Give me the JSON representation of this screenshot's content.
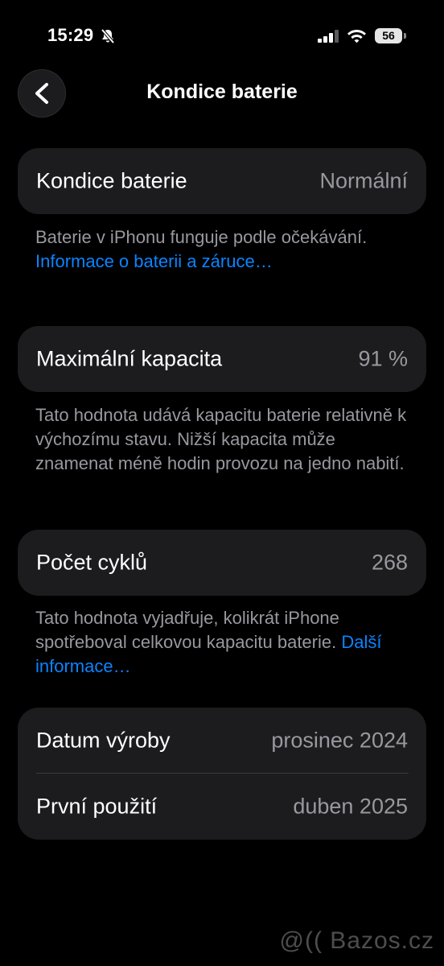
{
  "status_bar": {
    "time": "15:29",
    "battery_level": "56"
  },
  "nav": {
    "title": "Kondice baterie"
  },
  "battery_condition": {
    "label": "Kondice baterie",
    "value": "Normální",
    "footnote_text": "Baterie v iPhonu funguje podle očekávání. ",
    "footnote_link": "Informace o baterii a záruce…"
  },
  "max_capacity": {
    "label": "Maximální kapacita",
    "value": "91 %",
    "footnote_text": "Tato hodnota udává kapacitu baterie relativně k výchozímu stavu. Nižší kapacita může znamenat méně hodin provozu na jedno nabití."
  },
  "cycle_count": {
    "label": "Počet cyklů",
    "value": "268",
    "footnote_text": "Tato hodnota vyjadřuje, kolikrát iPhone spotřeboval celkovou kapacitu baterie. ",
    "footnote_link": "Další informace…"
  },
  "dates": {
    "manufacture_label": "Datum výroby",
    "manufacture_value": "prosinec 2024",
    "first_use_label": "První použití",
    "first_use_value": "duben 2025"
  },
  "watermark": "@(( Bazos.cz",
  "colors": {
    "background": "#000000",
    "cell": "#1c1c1e",
    "secondary_text": "#98989f",
    "link": "#0a84ff"
  }
}
